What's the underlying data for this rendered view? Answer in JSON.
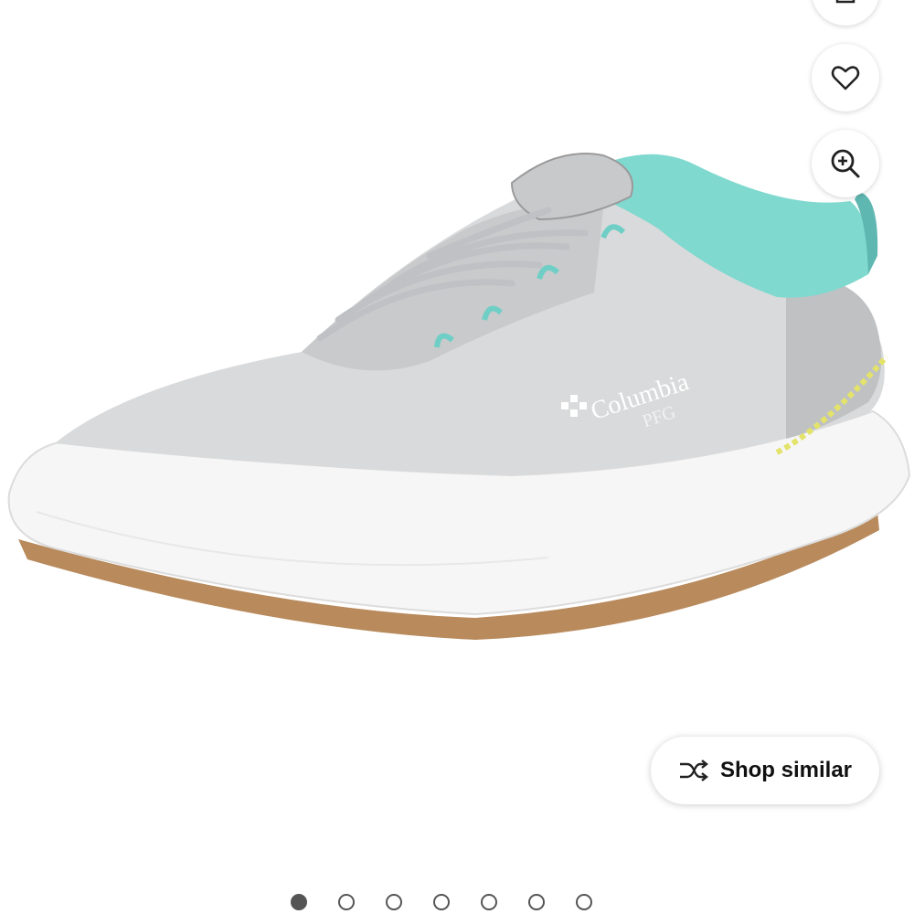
{
  "viewer": {
    "image_icon": "shoe-product-image",
    "brand_logo_text": "Columbia",
    "brand_logo_sub": "PFG"
  },
  "actions": {
    "share_icon": "share-icon",
    "favorite_icon": "heart-icon",
    "zoom_icon": "zoom-in-icon"
  },
  "shop_similar": {
    "label": "Shop similar",
    "icon": "shuffle-icon"
  },
  "carousel": {
    "total": 7,
    "active_index": 0
  },
  "colors": {
    "upper": "#d7d8da",
    "accent_teal": "#7dd6d0",
    "accent_yellow": "#e3e36a",
    "sole": "#f7f7f7",
    "gum": "#b88a5c"
  }
}
